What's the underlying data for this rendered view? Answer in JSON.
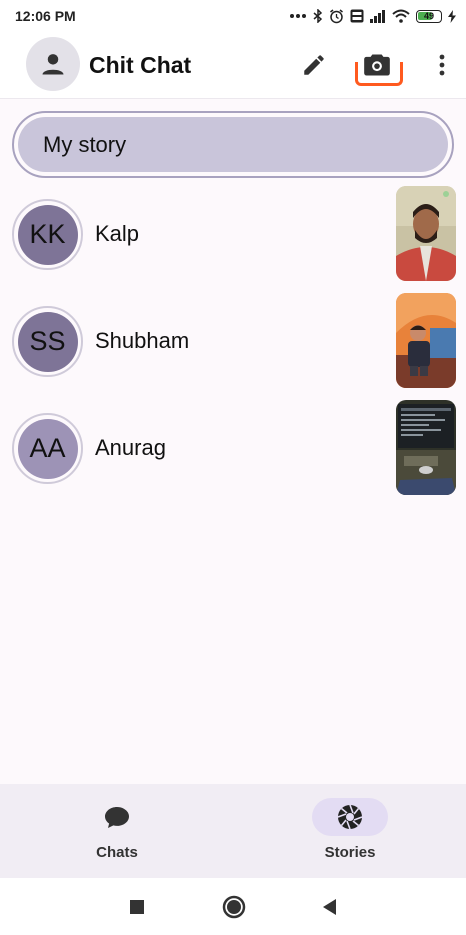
{
  "status_bar": {
    "time": "12:06 PM",
    "battery": "49",
    "icons": [
      "more-dots-icon",
      "bluetooth-icon",
      "alarm-icon",
      "volte-icon",
      "signal-icon",
      "wifi-icon",
      "battery-icon",
      "charging-icon"
    ]
  },
  "app_bar": {
    "title": "Chit Chat",
    "actions": [
      "edit-icon",
      "camera-icon",
      "more-vert-icon"
    ],
    "highlight_color": "#ff5a1f"
  },
  "my_story": {
    "label": "My story"
  },
  "stories": [
    {
      "initials": "KK",
      "name": "Kalp",
      "avatar_color": "#7e7497",
      "thumbnail": "photo-man-red-jacket"
    },
    {
      "initials": "SS",
      "name": "Shubham",
      "avatar_color": "#7e7497",
      "thumbnail": "photo-child-orange-tent"
    },
    {
      "initials": "AA",
      "name": "Anurag",
      "avatar_color": "#9d93b6",
      "thumbnail": "photo-desk-monitor"
    }
  ],
  "bottom_nav": {
    "items": [
      {
        "label": "Chats",
        "icon": "chat-bubble-icon",
        "selected": false
      },
      {
        "label": "Stories",
        "icon": "aperture-icon",
        "selected": true
      }
    ],
    "selected_color": "#e3dcf3"
  },
  "system_nav": {
    "buttons": [
      "recents-icon",
      "home-icon",
      "back-icon"
    ]
  }
}
